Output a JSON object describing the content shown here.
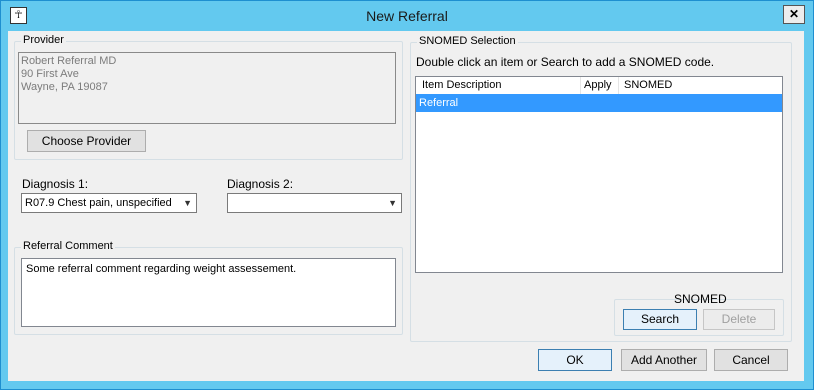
{
  "window": {
    "title": "New Referral"
  },
  "provider": {
    "legend": "Provider",
    "lines": [
      "Robert Referral MD",
      "90 First Ave",
      "Wayne, PA 19087"
    ],
    "choose_button": "Choose Provider"
  },
  "diagnosis1": {
    "label": "Diagnosis 1:",
    "value": "R07.9 Chest pain, unspecified"
  },
  "diagnosis2": {
    "label": "Diagnosis 2:",
    "value": ""
  },
  "comment": {
    "legend": "Referral Comment",
    "value": "Some referral comment regarding weight assessement."
  },
  "snomed": {
    "legend": "SNOMED Selection",
    "instructions": "Double click an item or Search to add a SNOMED code.",
    "columns": [
      "Item Description",
      "Apply",
      "SNOMED"
    ],
    "rows": [
      {
        "description": "Referral",
        "apply": "",
        "snomed": ""
      }
    ],
    "group_label": "SNOMED",
    "search_button": "Search",
    "delete_button": "Delete"
  },
  "buttons": {
    "ok": "OK",
    "add_another": "Add Another",
    "cancel": "Cancel"
  }
}
